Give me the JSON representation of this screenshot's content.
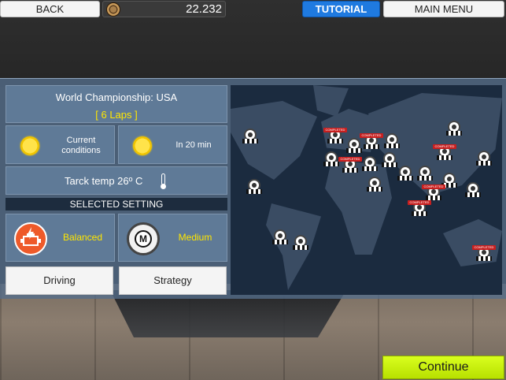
{
  "topbar": {
    "back_label": "BACK",
    "coins": "22.232",
    "tutorial_label": "TUTORIAL",
    "main_menu_label": "MAIN MENU"
  },
  "race": {
    "title": "World Championship: USA",
    "laps": "[ 6 Laps ]"
  },
  "weather": {
    "current_label": "Current conditions",
    "forecast_label": "In 20 min"
  },
  "track_temp_label": "Tarck temp 26º C",
  "selected_setting_label": "SELECTED SETTING",
  "settings": {
    "engine_mode": "Balanced",
    "tyre_compound": "Medium",
    "tyre_letter": "M"
  },
  "buttons": {
    "driving": "Driving",
    "strategy": "Strategy",
    "continue": "Continue"
  },
  "map": {
    "completed_tag": "COMPLETED",
    "markers": [
      {
        "id": "m1",
        "completed": false
      },
      {
        "id": "m2",
        "completed": true
      },
      {
        "id": "m3",
        "completed": false
      },
      {
        "id": "m4",
        "completed": true
      },
      {
        "id": "m5",
        "completed": false
      },
      {
        "id": "m6",
        "completed": false
      },
      {
        "id": "m7",
        "completed": true
      },
      {
        "id": "m8",
        "completed": false
      },
      {
        "id": "m9",
        "completed": false
      },
      {
        "id": "m10",
        "completed": false
      },
      {
        "id": "m11",
        "completed": false
      },
      {
        "id": "m12",
        "completed": false
      },
      {
        "id": "m13",
        "completed": true
      },
      {
        "id": "m14",
        "completed": false
      },
      {
        "id": "m15",
        "completed": false
      },
      {
        "id": "m16",
        "completed": true
      },
      {
        "id": "m17",
        "completed": false
      },
      {
        "id": "m18",
        "completed": true
      },
      {
        "id": "m19",
        "completed": false
      },
      {
        "id": "m20",
        "completed": false
      },
      {
        "id": "m21",
        "completed": true
      }
    ]
  },
  "colors": {
    "accent_yellow": "#ffe600",
    "tutorial_blue": "#1f7ae0",
    "continue_green": "#c8f000",
    "engine_orange": "#ee5a2a",
    "completed_red": "#c81f1f"
  }
}
